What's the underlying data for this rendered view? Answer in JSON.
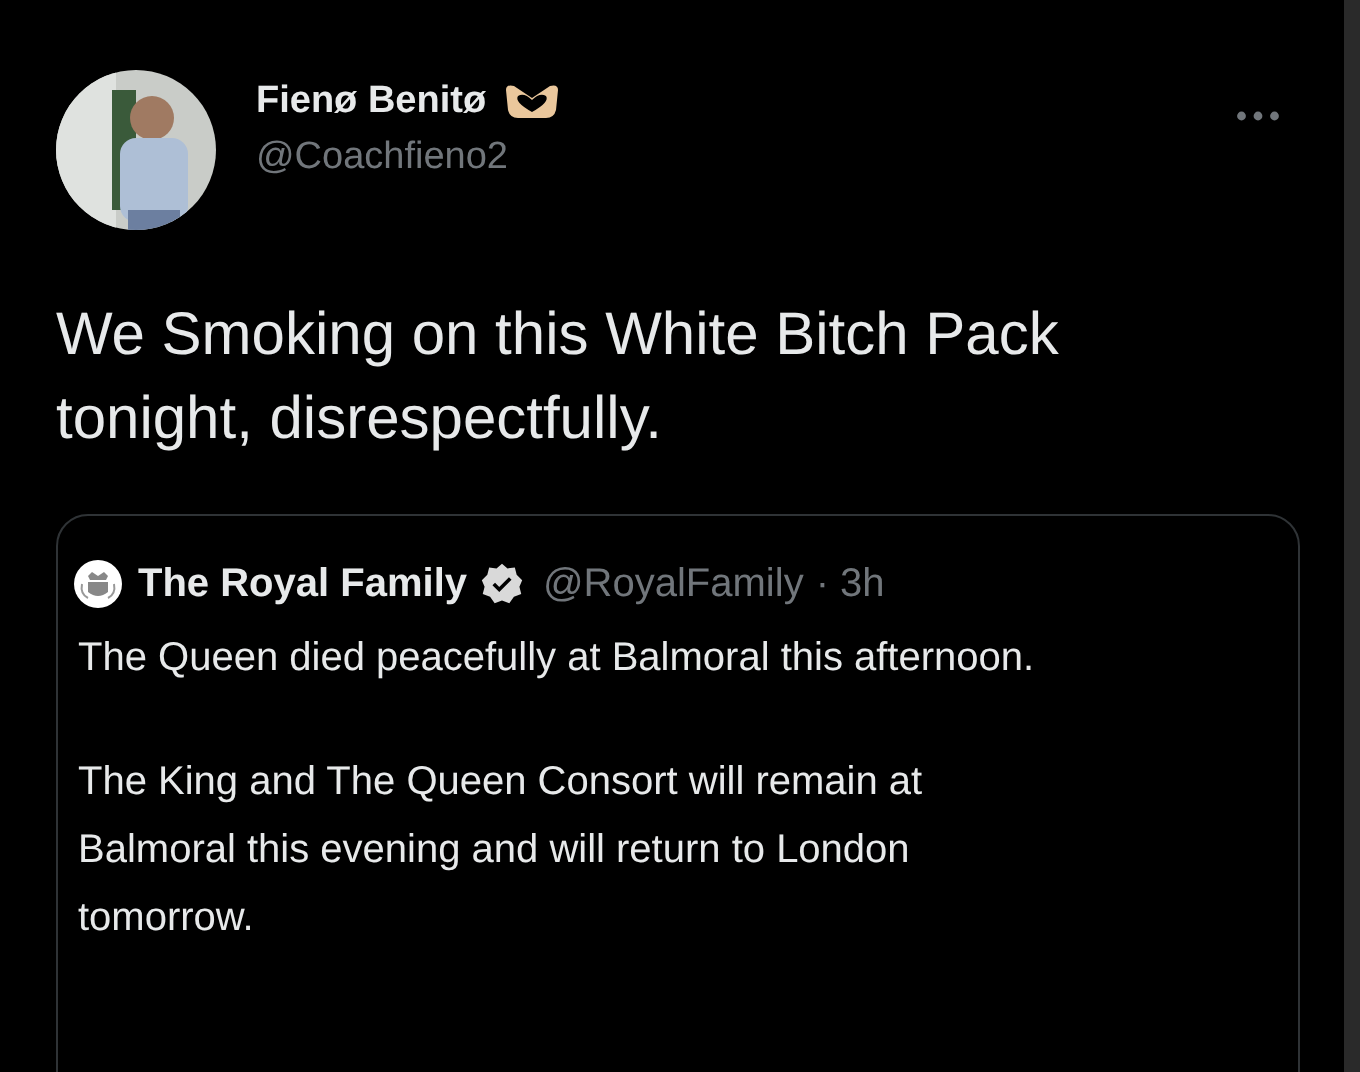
{
  "author": {
    "name": "Fienø Benitø",
    "handle": "@Coachfieno2"
  },
  "tweet_text": "We Smoking on this White Bitch Pack tonight, disrespectfully.",
  "quoted_tweet": {
    "name": "The Royal Family",
    "verified": true,
    "handle": "@RoyalFamily",
    "time": "· 3h",
    "paragraphs": [
      "The Queen died peacefully at Balmoral this afternoon.",
      "The King and The Queen Consort will remain at Balmoral this evening and will return to London tomorrow."
    ]
  }
}
